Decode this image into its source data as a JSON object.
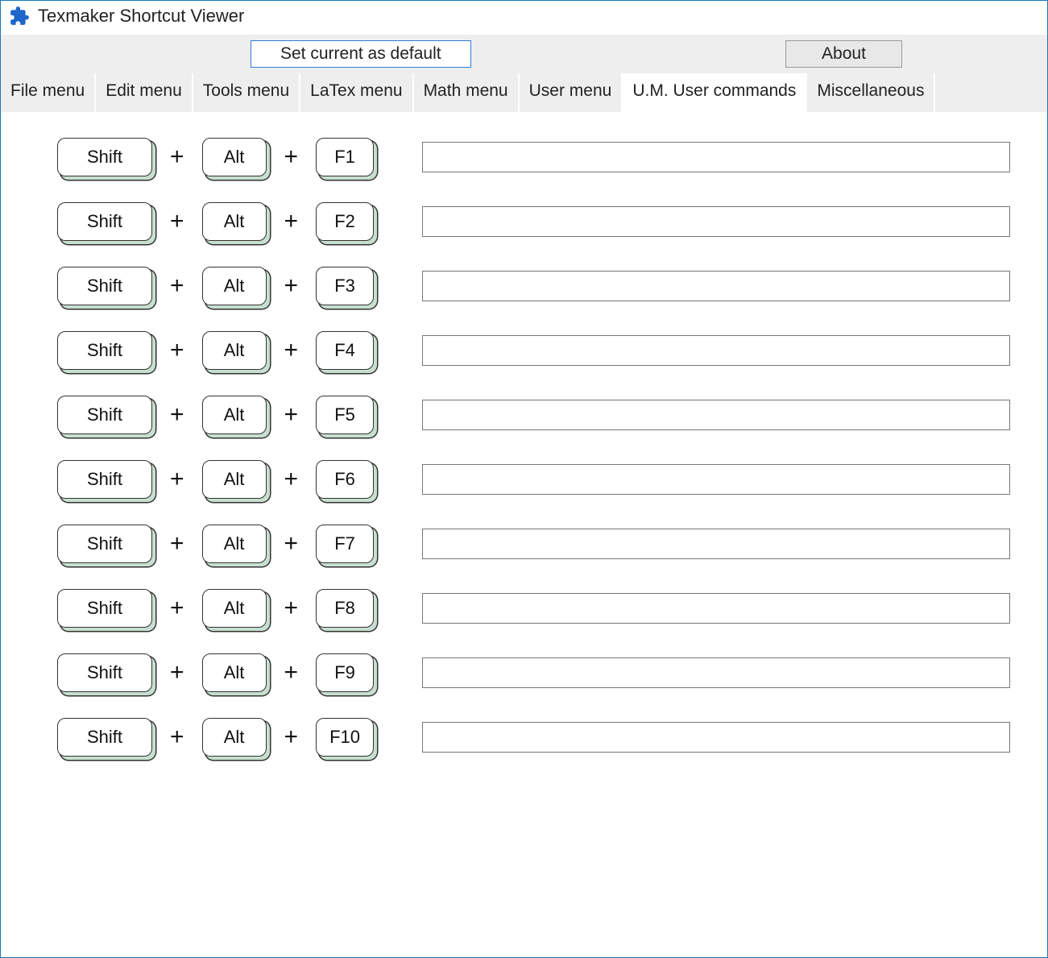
{
  "window": {
    "title": "Texmaker Shortcut Viewer"
  },
  "toolbar": {
    "set_default_label": "Set current as default",
    "about_label": "About"
  },
  "tabs": [
    {
      "label": "File menu",
      "active": false
    },
    {
      "label": "Edit menu",
      "active": false
    },
    {
      "label": "Tools menu",
      "active": false
    },
    {
      "label": "LaTex menu",
      "active": false
    },
    {
      "label": "Math menu",
      "active": false
    },
    {
      "label": "User menu",
      "active": false
    },
    {
      "label": "U.M. User commands",
      "active": true
    },
    {
      "label": "Miscellaneous",
      "active": false
    }
  ],
  "plus": "+",
  "shortcuts": [
    {
      "key1": "Shift",
      "key2": "Alt",
      "key3": "F1",
      "value": ""
    },
    {
      "key1": "Shift",
      "key2": "Alt",
      "key3": "F2",
      "value": ""
    },
    {
      "key1": "Shift",
      "key2": "Alt",
      "key3": "F3",
      "value": ""
    },
    {
      "key1": "Shift",
      "key2": "Alt",
      "key3": "F4",
      "value": ""
    },
    {
      "key1": "Shift",
      "key2": "Alt",
      "key3": "F5",
      "value": ""
    },
    {
      "key1": "Shift",
      "key2": "Alt",
      "key3": "F6",
      "value": ""
    },
    {
      "key1": "Shift",
      "key2": "Alt",
      "key3": "F7",
      "value": ""
    },
    {
      "key1": "Shift",
      "key2": "Alt",
      "key3": "F8",
      "value": ""
    },
    {
      "key1": "Shift",
      "key2": "Alt",
      "key3": "F9",
      "value": ""
    },
    {
      "key1": "Shift",
      "key2": "Alt",
      "key3": "F10",
      "value": ""
    }
  ]
}
